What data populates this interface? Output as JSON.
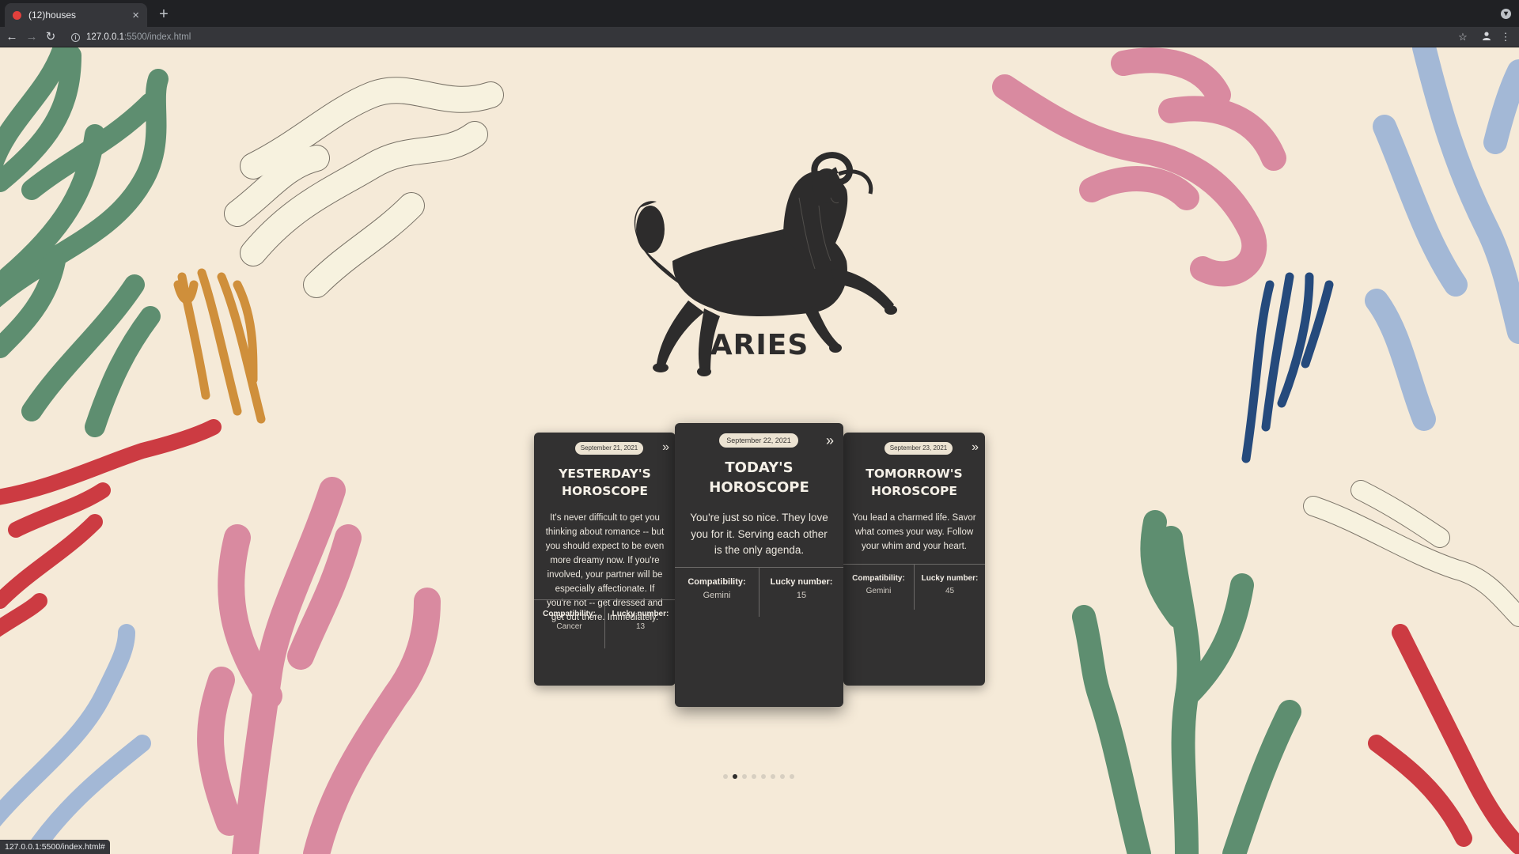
{
  "browser": {
    "tab_title": "(12)houses",
    "tab_close": "×",
    "new_tab": "+",
    "url_host": "127.0.0.1",
    "url_path": ":5500/index.html",
    "status_url": "127.0.0.1:5500/index.html#"
  },
  "sign": {
    "name": "ARIES"
  },
  "cards": {
    "yesterday": {
      "date": "September 21, 2021",
      "title_line1": "Yesterday's",
      "title_line2": "Horoscope",
      "text": "It's never difficult to get you thinking about romance -- but you should expect to be even more dreamy now. If you're involved, your partner will be especially affectionate. If you're not -- get dressed and get out there. Immediately.",
      "compatibility_label": "Compatibility:",
      "compatibility": "Cancer",
      "lucky_label": "Lucky number:",
      "lucky_number": "13"
    },
    "today": {
      "date": "September 22, 2021",
      "title_line1": "Today's",
      "title_line2": "Horoscope",
      "text": "You're just so nice. They love you for it. Serving each other is the only agenda.",
      "compatibility_label": "Compatibility:",
      "compatibility": "Gemini",
      "lucky_label": "Lucky number:",
      "lucky_number": "15"
    },
    "tomorrow": {
      "date": "September 23, 2021",
      "title_line1": "Tomorrow's",
      "title_line2": "Horoscope",
      "text": "You lead a charmed life. Savor what comes your way. Follow your whim and your heart.",
      "compatibility_label": "Compatibility:",
      "compatibility": "Gemini",
      "lucky_label": "Lucky number:",
      "lucky_number": "45"
    }
  },
  "pagination": {
    "total": 8,
    "active_index": 1
  },
  "colors": {
    "background": "#f5ead8",
    "card": "#323131",
    "green": "#5e8e70",
    "pink": "#d98aa0",
    "blue_light": "#a3b8d6",
    "navy": "#254a7c",
    "ochre": "#cf8f3b",
    "red": "#cc3b42",
    "cream": "#f7f2df"
  }
}
